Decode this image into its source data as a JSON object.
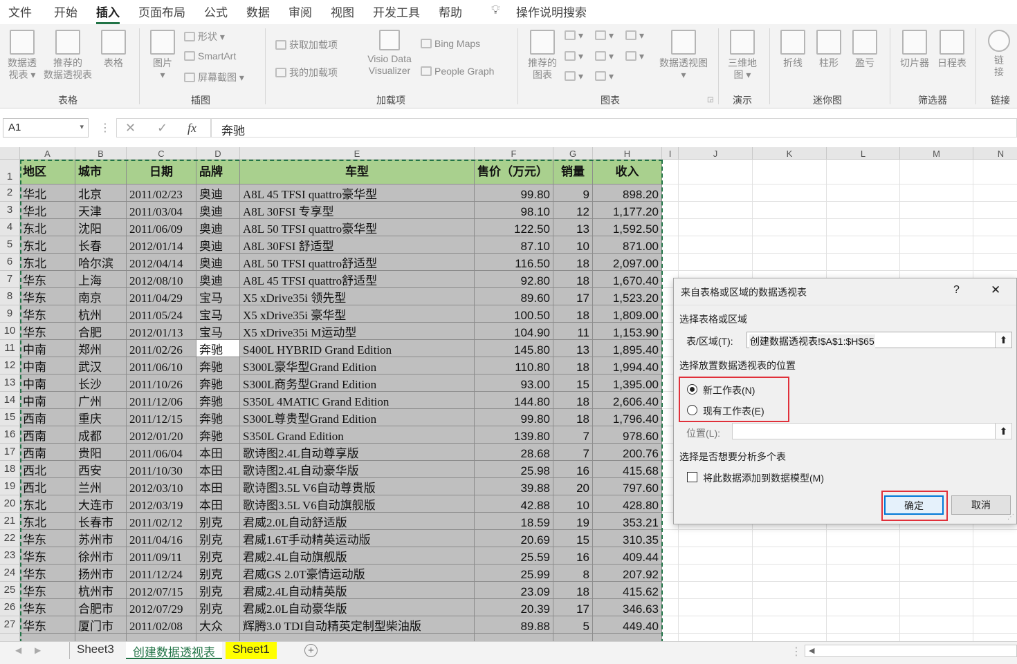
{
  "tabs": [
    "文件",
    "开始",
    "插入",
    "页面布局",
    "公式",
    "数据",
    "审阅",
    "视图",
    "开发工具",
    "帮助"
  ],
  "tell_me": "操作说明搜索",
  "ribbon": {
    "pivot": "数据透\n视表 ▾",
    "rec_pivot": "推荐的\n数据透视表",
    "table": "表格",
    "g_tables": "表格",
    "picture": "图片\n▾",
    "shapes": "形状 ▾",
    "smartart": "SmartArt",
    "screenshot": "屏幕截图 ▾",
    "g_illust": "插图",
    "get_addins": "获取加载项",
    "my_addins": "我的加载项",
    "visio": "Visio Data\nVisualizer",
    "bing": "Bing Maps",
    "people": "People Graph",
    "g_addins": "加载项",
    "rec_charts": "推荐的\n图表",
    "pivotchart": "数据透视图\n▾",
    "g_charts": "图表",
    "map3d": "三维地\n图 ▾",
    "g_tours": "演示",
    "line": "折线",
    "column": "柱形",
    "winloss": "盈亏",
    "g_spark": "迷你图",
    "slicer": "切片器",
    "timeline": "日程表",
    "g_filters": "筛选器",
    "link": "链\n接",
    "g_links": "链接"
  },
  "formula_bar": {
    "name_box": "A1",
    "cancel": "✕",
    "enter": "✓",
    "fx": "fx",
    "content": "奔驰"
  },
  "columns": [
    "A",
    "B",
    "C",
    "D",
    "E",
    "F",
    "G",
    "H",
    "I",
    "J",
    "K",
    "L",
    "M",
    "N"
  ],
  "headers": [
    "地区",
    "城市",
    "日期",
    "品牌",
    "车型",
    "售价（万元）",
    "销量",
    "收入"
  ],
  "rows": [
    [
      "华北",
      "北京",
      "2011/02/23",
      "奥迪",
      "A8L 45 TFSI quattro豪华型",
      "99.80",
      "9",
      "898.20"
    ],
    [
      "华北",
      "天津",
      "2011/03/04",
      "奥迪",
      "A8L 30FSI 专享型",
      "98.10",
      "12",
      "1,177.20"
    ],
    [
      "东北",
      "沈阳",
      "2011/06/09",
      "奥迪",
      "A8L 50 TFSI quattro豪华型",
      "122.50",
      "13",
      "1,592.50"
    ],
    [
      "东北",
      "长春",
      "2012/01/14",
      "奥迪",
      "A8L 30FSI 舒适型",
      "87.10",
      "10",
      "871.00"
    ],
    [
      "东北",
      "哈尔滨",
      "2012/04/14",
      "奥迪",
      "A8L 50 TFSI quattro舒适型",
      "116.50",
      "18",
      "2,097.00"
    ],
    [
      "华东",
      "上海",
      "2012/08/10",
      "奥迪",
      "A8L 45 TFSI quattro舒适型",
      "92.80",
      "18",
      "1,670.40"
    ],
    [
      "华东",
      "南京",
      "2011/04/29",
      "宝马",
      "X5 xDrive35i 领先型",
      "89.60",
      "17",
      "1,523.20"
    ],
    [
      "华东",
      "杭州",
      "2011/05/24",
      "宝马",
      "X5 xDrive35i 豪华型",
      "100.50",
      "18",
      "1,809.00"
    ],
    [
      "华东",
      "合肥",
      "2012/01/13",
      "宝马",
      "X5 xDrive35i M运动型",
      "104.90",
      "11",
      "1,153.90"
    ],
    [
      "中南",
      "郑州",
      "2011/02/26",
      "奔驰",
      "S400L HYBRID Grand Edition",
      "145.80",
      "13",
      "1,895.40"
    ],
    [
      "中南",
      "武汉",
      "2011/06/10",
      "奔驰",
      "S300L豪华型Grand Edition",
      "110.80",
      "18",
      "1,994.40"
    ],
    [
      "中南",
      "长沙",
      "2011/10/26",
      "奔驰",
      "S300L商务型Grand Edition",
      "93.00",
      "15",
      "1,395.00"
    ],
    [
      "中南",
      "广州",
      "2011/12/06",
      "奔驰",
      "S350L 4MATIC Grand Edition",
      "144.80",
      "18",
      "2,606.40"
    ],
    [
      "西南",
      "重庆",
      "2011/12/15",
      "奔驰",
      "S300L尊贵型Grand Edition",
      "99.80",
      "18",
      "1,796.40"
    ],
    [
      "西南",
      "成都",
      "2012/01/20",
      "奔驰",
      "S350L Grand Edition",
      "139.80",
      "7",
      "978.60"
    ],
    [
      "西南",
      "贵阳",
      "2011/06/04",
      "本田",
      "歌诗图2.4L自动尊享版",
      "28.68",
      "7",
      "200.76"
    ],
    [
      "西北",
      "西安",
      "2011/10/30",
      "本田",
      "歌诗图2.4L自动豪华版",
      "25.98",
      "16",
      "415.68"
    ],
    [
      "西北",
      "兰州",
      "2012/03/10",
      "本田",
      "歌诗图3.5L V6自动尊贵版",
      "39.88",
      "20",
      "797.60"
    ],
    [
      "东北",
      "大连市",
      "2012/03/19",
      "本田",
      "歌诗图3.5L V6自动旗舰版",
      "42.88",
      "10",
      "428.80"
    ],
    [
      "东北",
      "长春市",
      "2011/02/12",
      "别克",
      "君威2.0L自动舒适版",
      "18.59",
      "19",
      "353.21"
    ],
    [
      "华东",
      "苏州市",
      "2011/04/16",
      "别克",
      "君威1.6T手动精英运动版",
      "20.69",
      "15",
      "310.35"
    ],
    [
      "华东",
      "徐州市",
      "2011/09/11",
      "别克",
      "君威2.4L自动旗舰版",
      "25.59",
      "16",
      "409.44"
    ],
    [
      "华东",
      "扬州市",
      "2011/12/24",
      "别克",
      "君威GS 2.0T豪情运动版",
      "25.99",
      "8",
      "207.92"
    ],
    [
      "华东",
      "杭州市",
      "2012/07/15",
      "别克",
      "君威2.4L自动精英版",
      "23.09",
      "18",
      "415.62"
    ],
    [
      "华东",
      "合肥市",
      "2012/07/29",
      "别克",
      "君威2.0L自动豪华版",
      "20.39",
      "17",
      "346.63"
    ],
    [
      "华东",
      "厦门市",
      "2011/02/08",
      "大众",
      "辉腾3.0 TDI自动精英定制型柴油版",
      "89.88",
      "5",
      "449.40"
    ]
  ],
  "sheets": [
    {
      "name": "Sheet3",
      "style": "normal"
    },
    {
      "name": "创建数据透视表",
      "style": "active"
    },
    {
      "name": "Sheet1",
      "style": "yellow"
    }
  ],
  "dialog": {
    "title": "来自表格或区域的数据透视表",
    "help": "?",
    "close": "✕",
    "sec_range": "选择表格或区域",
    "range_label": "表/区域(T):",
    "range_value": "创建数据透视表!$A$1:$H$65",
    "sec_place": "选择放置数据透视表的位置",
    "new_sheet": "新工作表(N)",
    "existing_sheet": "现有工作表(E)",
    "location_label": "位置(L):",
    "sec_multi": "选择是否想要分析多个表",
    "add_model": "将此数据添加到数据模型(M)",
    "ok": "确定",
    "cancel": "取消",
    "collapse_icon": "⬆"
  }
}
